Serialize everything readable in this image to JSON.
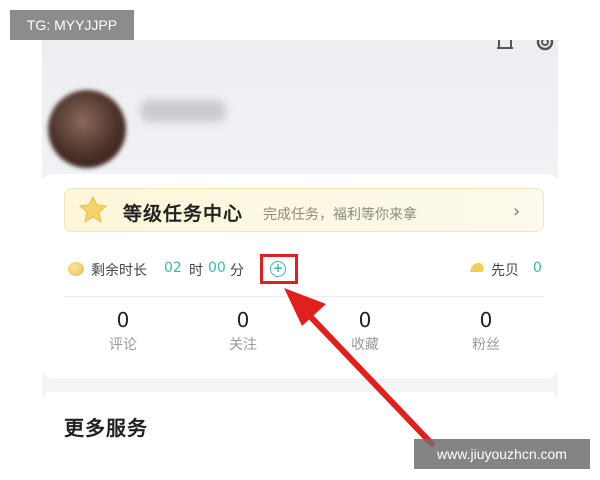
{
  "watermarks": {
    "top_left": "TG: MYYJJPP",
    "bottom_right": "www.jiuyouzhcn.com"
  },
  "level_banner": {
    "title": "等级任务中心",
    "subtitle": "完成任务，福利等你来拿",
    "chevron": "›"
  },
  "time_row": {
    "label": "剩余时长",
    "hours": "02",
    "hours_unit": "时",
    "minutes": "00",
    "minutes_unit": "分",
    "add_icon": "plus-circle-icon",
    "shell_label": "先贝",
    "shell_value": "0"
  },
  "stats": [
    {
      "value": "0",
      "label": "评论"
    },
    {
      "value": "0",
      "label": "关注"
    },
    {
      "value": "0",
      "label": "收藏"
    },
    {
      "value": "0",
      "label": "粉丝"
    }
  ],
  "more_services": {
    "title": "更多服务"
  },
  "colors": {
    "accent_teal": "#3bb9a8",
    "highlight_red": "#e0201e",
    "banner_bg": "#fdf6d8"
  }
}
